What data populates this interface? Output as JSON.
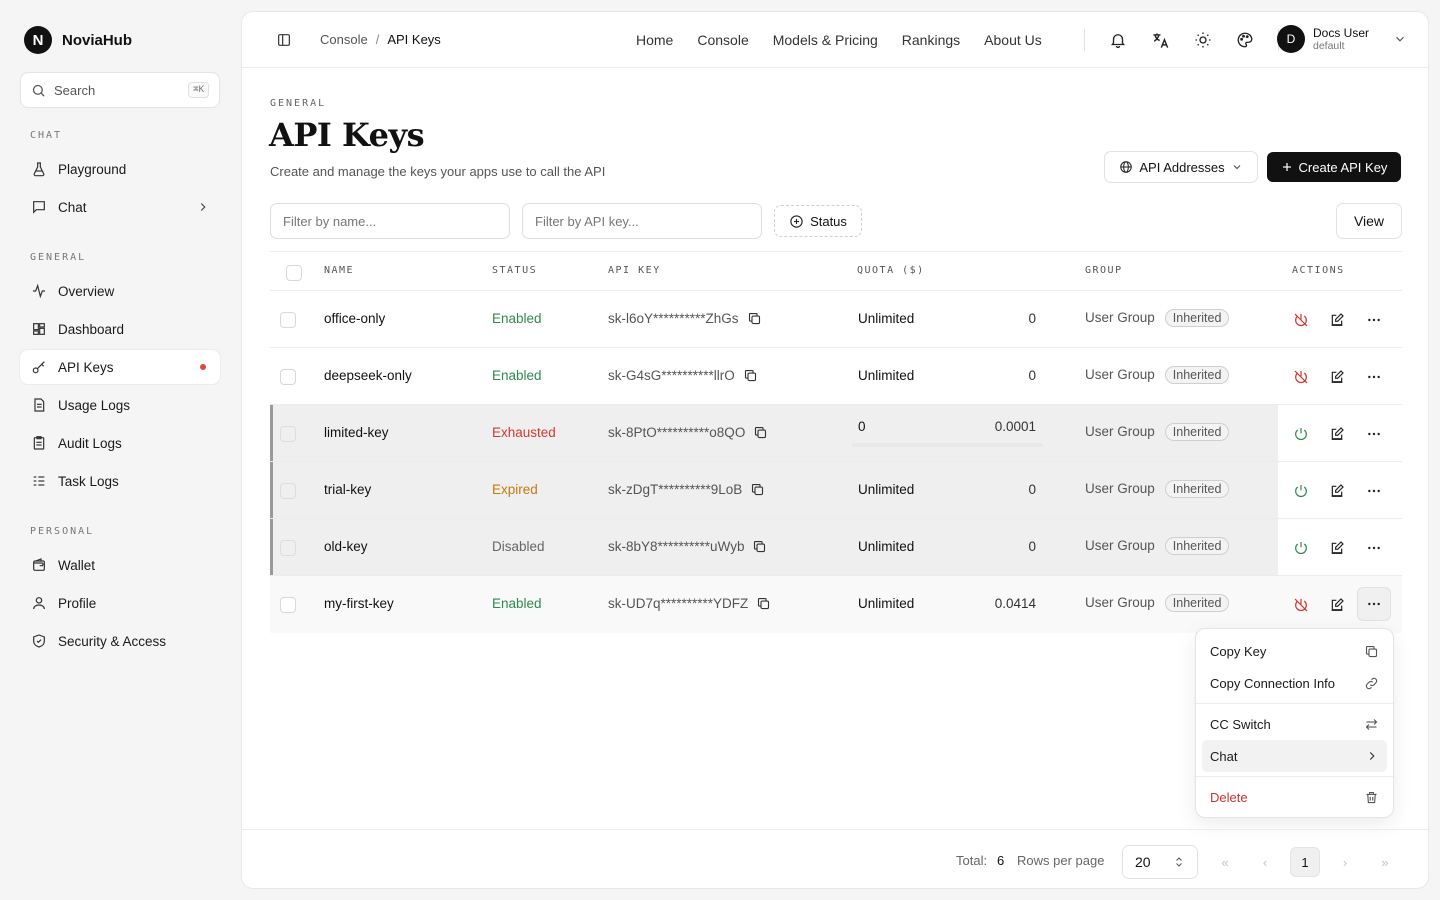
{
  "brand": {
    "logo": "N",
    "name": "NoviaHub"
  },
  "search": {
    "placeholder": "Search",
    "shortcut": "⌘K"
  },
  "sidebar": {
    "sections": [
      {
        "label": "CHAT",
        "items": [
          {
            "label": "Playground",
            "icon": "flask-icon"
          },
          {
            "label": "Chat",
            "icon": "message-icon",
            "has_submenu": true
          }
        ]
      },
      {
        "label": "GENERAL",
        "items": [
          {
            "label": "Overview",
            "icon": "activity-icon"
          },
          {
            "label": "Dashboard",
            "icon": "dashboard-icon"
          },
          {
            "label": "API Keys",
            "icon": "key-icon",
            "active": true,
            "indicator": true
          },
          {
            "label": "Usage Logs",
            "icon": "document-icon"
          },
          {
            "label": "Audit Logs",
            "icon": "clipboard-icon"
          },
          {
            "label": "Task Logs",
            "icon": "list-check-icon"
          }
        ]
      },
      {
        "label": "PERSONAL",
        "items": [
          {
            "label": "Wallet",
            "icon": "wallet-icon"
          },
          {
            "label": "Profile",
            "icon": "user-icon"
          },
          {
            "label": "Security & Access",
            "icon": "shield-icon"
          }
        ]
      }
    ]
  },
  "header": {
    "breadcrumb": [
      "Console",
      "API Keys"
    ],
    "nav": [
      "Home",
      "Console",
      "Models & Pricing",
      "Rankings",
      "About Us"
    ],
    "user": {
      "avatar": "D",
      "name": "Docs User",
      "group": "default"
    }
  },
  "page": {
    "eyebrow": "GENERAL",
    "title": "API Keys",
    "subtitle": "Create and manage the keys your apps use to call the API",
    "api_addresses_label": "API Addresses",
    "create_label": "Create API Key",
    "filter_name_placeholder": "Filter by name...",
    "filter_key_placeholder": "Filter by API key...",
    "status_filter_label": "Status",
    "view_label": "View"
  },
  "table": {
    "columns": [
      "NAME",
      "STATUS",
      "API KEY",
      "QUOTA ($)",
      "GROUP",
      "ACTIONS"
    ],
    "rows": [
      {
        "name": "office-only",
        "status": "Enabled",
        "status_kind": "enabled",
        "key": "sk-l6oY**********ZhGs",
        "quota": "Unlimited",
        "used": "0",
        "group": "User Group",
        "badge": "Inherited",
        "toggle": "disable"
      },
      {
        "name": "deepseek-only",
        "status": "Enabled",
        "status_kind": "enabled",
        "key": "sk-G4sG**********llrO",
        "quota": "Unlimited",
        "used": "0",
        "group": "User Group",
        "badge": "Inherited",
        "toggle": "disable"
      },
      {
        "name": "limited-key",
        "status": "Exhausted",
        "status_kind": "exhausted",
        "key": "sk-8PtO**********o8QO",
        "quota": "0",
        "used": "0.0001",
        "group": "User Group",
        "badge": "Inherited",
        "toggle": "enable"
      },
      {
        "name": "trial-key",
        "status": "Expired",
        "status_kind": "expired",
        "key": "sk-zDgT**********9LoB",
        "quota": "Unlimited",
        "used": "0",
        "group": "User Group",
        "badge": "Inherited",
        "toggle": "enable"
      },
      {
        "name": "old-key",
        "status": "Disabled",
        "status_kind": "disabled",
        "key": "sk-8bY8**********uWyb",
        "quota": "Unlimited",
        "used": "0",
        "group": "User Group",
        "badge": "Inherited",
        "toggle": "enable"
      },
      {
        "name": "my-first-key",
        "status": "Enabled",
        "status_kind": "enabled",
        "key": "sk-UD7q**********YDFZ",
        "quota": "Unlimited",
        "used": "0.0414",
        "group": "User Group",
        "badge": "Inherited",
        "toggle": "disable"
      }
    ]
  },
  "menu": {
    "items": [
      "Copy Key",
      "Copy Connection Info",
      "CC Switch",
      "Chat",
      "Delete"
    ]
  },
  "footer": {
    "total_label": "Total:",
    "total": "6",
    "rows_per_page_label": "Rows per page",
    "rows_per_page": "20",
    "current_page": "1"
  },
  "colors": {
    "enabled": "#2f8a4c",
    "exhausted": "#d03a2f",
    "expired": "#c27a12",
    "disabled": "#666666",
    "danger": "#d0342c"
  }
}
